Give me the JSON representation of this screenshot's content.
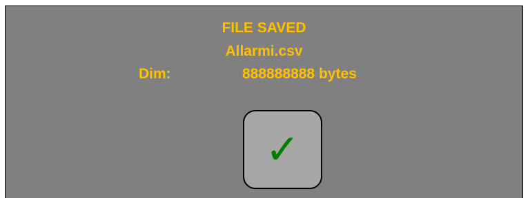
{
  "dialog": {
    "title": "FILE SAVED",
    "filename": "Allarmi.csv",
    "size_label": "Dim:",
    "size_value": "888888888 bytes",
    "text_color": "#ffc000",
    "background_color": "#808080"
  },
  "ok_button": {
    "icon": "check-icon",
    "glyph": "✓",
    "icon_color": "#008000",
    "background_color": "#a6a6a6"
  }
}
